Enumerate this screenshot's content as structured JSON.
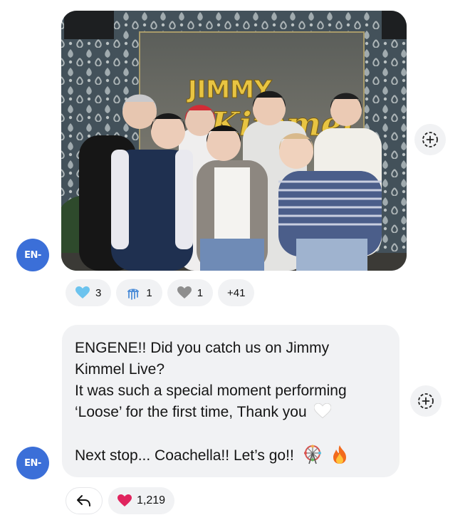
{
  "messages": [
    {
      "type": "photo",
      "sender_avatar": "EN-",
      "photo_sign_line1": "JIMMY",
      "photo_sign_line2": "Kimmel",
      "reactions": [
        {
          "icon": "blue-heart",
          "count": "3"
        },
        {
          "icon": "jellyfish",
          "count": "1"
        },
        {
          "icon": "grey-heart",
          "count": "1"
        }
      ],
      "more_reactions": "+41"
    },
    {
      "type": "text",
      "sender_avatar": "EN-",
      "lines": [
        "ENGENE!! Did you catch us on Jimmy",
        "Kimmel Live?",
        "It was such a special moment performing",
        "‘Loose’ for the first time, Thank you",
        "",
        "Next stop... Coachella!! Let’s go!!"
      ],
      "inline_emojis": [
        "white-heart",
        "ferris-wheel",
        "fire"
      ],
      "like_count": "1,219"
    }
  ],
  "colors": {
    "avatar": "#3b6fd8",
    "bubble": "#f1f2f4",
    "like_heart": "#e0245e"
  }
}
